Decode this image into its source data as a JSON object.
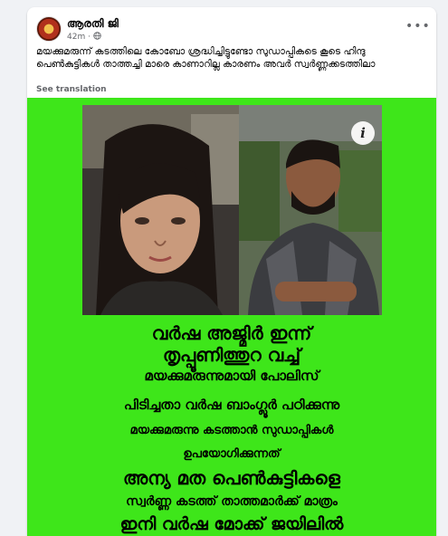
{
  "post": {
    "author": "ആരതി ജി",
    "time": "42m",
    "privacy_icon": "globe-icon",
    "more_icon": "more-dots-icon",
    "more_label": "•••",
    "text": "മയക്കുമരുന്ന് കടത്തിലെ കോബോ ശ്രദ്ധിച്ചിട്ടുണ്ടോ സുഡാപ്പികടെ കൂടെ ഹിന്ദു പെൺകുട്ടികൾ താത്തച്ചി മാരെ കാണാറില്ല കാരണം അവർ സ്വർണ്ണക്കടത്തിലാ",
    "translate_label": "See translation"
  },
  "media": {
    "background": "#3ee61a",
    "info_label": "i",
    "captions": [
      "വർഷ അജ്മിർ ഇന്ന്",
      "തൃപ്പൂണിത്തുറ വച്ച്",
      "മയക്കുമരുന്നുമായി പോലിസ്",
      "പിടിച്ചതാ വർഷ ബാംഗ്ലൂർ പഠിക്കുന്നു",
      "മയക്കുമരുന്നു കടത്താൻ സുഡാപ്പികൾ",
      "ഉപയോഗിക്കുന്നത്",
      "അന്യ മത പെൺകുട്ടികളെ",
      "സ്വർണ്ണ കടത്ത് താത്തമാർക്ക് മാത്രം",
      "ഇനി വർഷ മോക്ക് ജയിലിൽ"
    ]
  }
}
